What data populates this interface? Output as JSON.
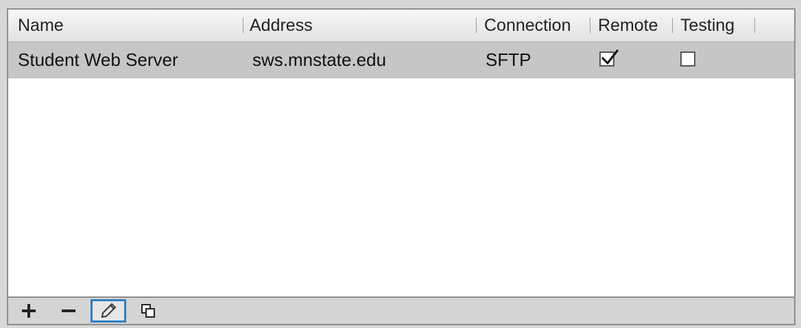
{
  "table": {
    "columns": [
      {
        "label": "Name"
      },
      {
        "label": "Address"
      },
      {
        "label": "Connection"
      },
      {
        "label": "Remote"
      },
      {
        "label": "Testing"
      }
    ],
    "rows": [
      {
        "name": "Student Web Server",
        "address": "sws.mnstate.edu",
        "connection": "SFTP",
        "remote": true,
        "testing": false
      }
    ]
  },
  "toolbar": {
    "add_icon": "plus-icon",
    "remove_icon": "minus-icon",
    "edit_icon": "pencil-icon",
    "duplicate_icon": "duplicate-icon"
  },
  "colors": {
    "selected_row": "#c6c6c6",
    "focus_border": "#2f7fc4"
  }
}
